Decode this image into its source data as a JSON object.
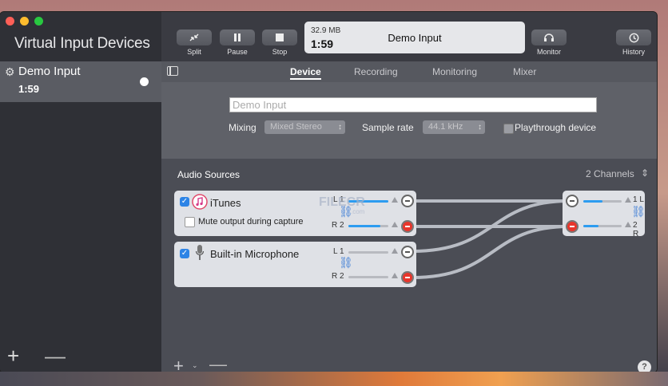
{
  "window": {
    "title": "Virtual Input Devices"
  },
  "sidebar": {
    "items": [
      {
        "name": "Demo Input",
        "time": "1:59"
      }
    ],
    "add_label": "+",
    "remove_label": "—"
  },
  "toolbar": {
    "split": "Split",
    "pause": "Pause",
    "stop": "Stop",
    "monitor": "Monitor",
    "history": "History",
    "lcd": {
      "size": "32.9 MB",
      "time": "1:59",
      "device_name": "Demo Input"
    }
  },
  "tabs": [
    "Device",
    "Recording",
    "Monitoring",
    "Mixer"
  ],
  "device": {
    "name_value": "Demo Input",
    "mixing_label": "Mixing",
    "mixing_value": "Mixed Stereo",
    "sample_rate_label": "Sample rate",
    "sample_rate_value": "44.1 kHz",
    "playthrough_label": "Playthrough device",
    "playthrough_checked": false
  },
  "audio_sources": {
    "title": "Audio Sources",
    "channels": "2 Channels",
    "sources": [
      {
        "name": "iTunes",
        "icon": "itunes-icon",
        "checked": true,
        "mute_label": "Mute output during capture",
        "mute_checked": false,
        "left": "L 1",
        "right": "R 2"
      },
      {
        "name": "Built-in Microphone",
        "icon": "microphone-icon",
        "checked": true,
        "left": "L 1",
        "right": "R 2"
      }
    ],
    "output": {
      "left": "1 L",
      "right": "2 R"
    }
  },
  "footer": {
    "add": "+",
    "caret": "⌄",
    "remove": "—",
    "help": "?"
  },
  "watermark": {
    "text": "FILECR",
    "sub": ".com"
  },
  "colors": {
    "accent": "#2d84e6",
    "sidebar_bg": "#2f3036",
    "selected_bg": "#5a5c63"
  }
}
